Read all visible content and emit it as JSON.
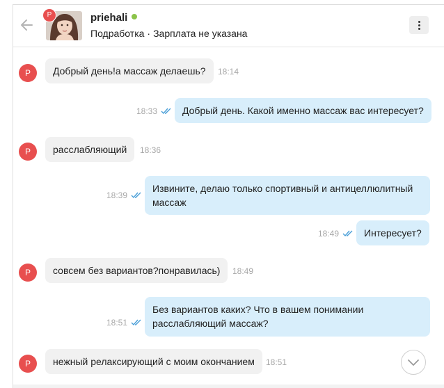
{
  "header": {
    "avatar_badge": "P",
    "username": "priehali",
    "vacancy": "Подработка",
    "separator": "·",
    "salary": "Зарплата не указана",
    "online_color": "#8bc34a"
  },
  "messages": [
    {
      "dir": "in",
      "avatar": "P",
      "text": "Добрый день!а массаж делаешь?",
      "time": "18:14"
    },
    {
      "dir": "out",
      "text": "Добрый день. Какой именно массаж вас интересует?",
      "time": "18:33"
    },
    {
      "dir": "in",
      "avatar": "P",
      "text": "расслабляющий",
      "time": "18:36"
    },
    {
      "dir": "out",
      "line1": "Извините, делаю только спортивный и антицеллюлитный",
      "line2": "массаж",
      "time": "18:39"
    },
    {
      "dir": "out",
      "text": "Интересует?",
      "time": "18:49"
    },
    {
      "dir": "in",
      "avatar": "P",
      "text": "совсем без вариантов?понравилась)",
      "time": "18:49"
    },
    {
      "dir": "out",
      "line1": "Без вариантов каких? Что в вашем понимании",
      "line2": "расслабляющий массаж?",
      "time": "18:51"
    },
    {
      "dir": "in",
      "avatar": "P",
      "text": "нежный релаксирующий с моим окончанием",
      "time": "18:51"
    }
  ],
  "colors": {
    "incoming_bubble": "#f1f1f1",
    "outgoing_bubble": "#d8eefb",
    "avatar_badge": "#e84f4f",
    "read_ticks": "#4a9fd8"
  },
  "icons": {
    "back": "arrow-left-icon",
    "menu": "more-vertical-icon",
    "read": "double-check-icon",
    "scroll": "chevron-down-icon"
  }
}
